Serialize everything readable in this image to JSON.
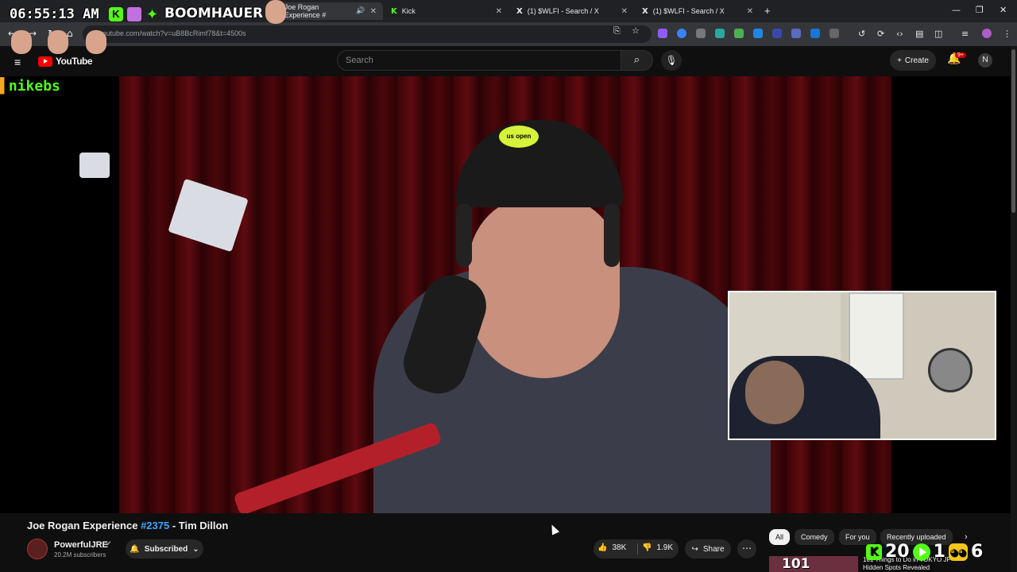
{
  "browser": {
    "tabs": [
      {
        "label": "Joe Rogan Experience #",
        "active": true
      },
      {
        "label": "Kick",
        "active": false
      },
      {
        "label": "(1) $WLFI - Search / X",
        "active": false
      },
      {
        "label": "(1) $WLFI - Search / X",
        "active": false
      }
    ],
    "url": "youtube.com/watch?v=uB8BcRimf78&t=4500s"
  },
  "youtube": {
    "logo": "YouTube",
    "search_placeholder": "Search",
    "create_label": "Create",
    "notification_count": "9+",
    "avatar_initial": "N"
  },
  "video": {
    "title_prefix": "Joe Rogan Experience ",
    "title_tag": "#2375",
    "title_suffix": " - Tim Dillon",
    "cap_text": "us open"
  },
  "channel": {
    "name": "PowerfulJRE",
    "subscribers": "20.2M subscribers",
    "subscribed_label": "Subscribed"
  },
  "actions": {
    "likes": "38K",
    "dislikes": "1.9K",
    "share_label": "Share"
  },
  "chips": [
    "All",
    "Comedy",
    "For you",
    "Recently uploaded"
  ],
  "recommended": {
    "thumb_text": "101",
    "title": "101 Things to Do in TOKYO JP Hidden Spots Revealed"
  },
  "overlay": {
    "clock": "06:55:13 AM",
    "streamer": "BOOMHAUER",
    "chat_user": "nikebs",
    "counter_kick": "20",
    "counter_play": "1",
    "counter_bot": "6"
  },
  "colors": {
    "kick_green": "#53fc18",
    "youtube_red": "#ff0000",
    "link_blue": "#3ea6ff"
  }
}
